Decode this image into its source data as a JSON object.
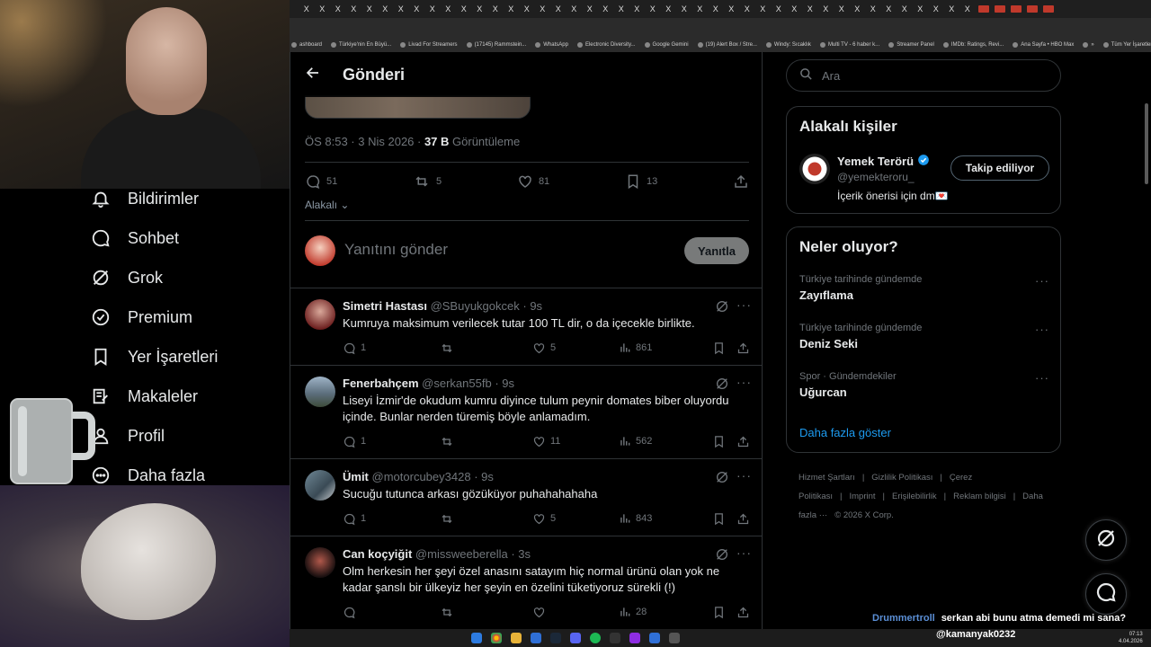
{
  "browser": {
    "tab_glyph": "X",
    "bookmarks": [
      "ashboard",
      "Türkiye'nin En Büyü...",
      "Livad For Streamers",
      "(17145) Rammstein...",
      "WhatsApp",
      "Electronic Diversity...",
      "Google Gemini",
      "(19) Alert Box / Stre...",
      "Windy: Sıcaklık",
      "Multi TV - 6 haber k...",
      "Streamer Panel",
      "IMDb: Ratings, Revi...",
      "Ana Sayfa • HBO Max",
      "»",
      "Tüm Yer İşaretleri"
    ]
  },
  "sidebar": {
    "items": [
      {
        "label": "Bildirimler",
        "icon": "bell-icon"
      },
      {
        "label": "Sohbet",
        "icon": "chat-icon"
      },
      {
        "label": "Grok",
        "icon": "grok-icon"
      },
      {
        "label": "Premium",
        "icon": "verified-icon"
      },
      {
        "label": "Yer İşaretleri",
        "icon": "bookmark-icon"
      },
      {
        "label": "Makaleler",
        "icon": "article-icon"
      },
      {
        "label": "Profil",
        "icon": "person-icon"
      },
      {
        "label": "Daha fazla",
        "icon": "more-circle-icon"
      }
    ]
  },
  "post": {
    "header_title": "Gönderi",
    "time": "ÖS 8:53 · 3 Nis 2026 · ",
    "views_count": "37 B",
    "views_label": " Görüntüleme",
    "replies": "51",
    "reposts": "5",
    "likes": "81",
    "bookmarks": "13",
    "related_label": "Alakalı",
    "reply_placeholder": "Yanıtını gönder",
    "reply_button": "Yanıtla"
  },
  "replies": [
    {
      "name": "Simetri Hastası",
      "handle": "@SBuyukgokcek",
      "time": "· 9s",
      "text": "Kumruya maksimum verilecek tutar 100 TL dir, o da içecekle birlikte.",
      "replies": "1",
      "reposts": "",
      "likes": "5",
      "views": "861"
    },
    {
      "name": "Fenerbahçem",
      "handle": "@serkan55fb",
      "time": "· 9s",
      "text": "Liseyi İzmir'de okudum kumru diyince tulum peynir domates biber oluyordu içinde. Bunlar nerden türemiş böyle anlamadım.",
      "replies": "1",
      "reposts": "",
      "likes": "11",
      "views": "562"
    },
    {
      "name": "Ümit",
      "handle": "@motorcubey3428",
      "time": "· 9s",
      "text": "Sucuğu tutunca arkası gözüküyor puhahahahaha",
      "replies": "1",
      "reposts": "",
      "likes": "5",
      "views": "843"
    },
    {
      "name": "Can koçyiğit",
      "handle": "@missweeberella",
      "time": "· 3s",
      "text": "Olm herkesin her şeyi özel anasını satayım hiç normal ürünü olan yok ne kadar şanslı bir ülkeyiz her şeyin en özelini tüketiyoruz sürekli (!)",
      "replies": "",
      "reposts": "",
      "likes": "",
      "views": "28"
    }
  ],
  "right": {
    "search_placeholder": "Ara",
    "people_title": "Alakalı kişiler",
    "person_name": "Yemek Terörü",
    "person_handle": "@yemekteroru_",
    "person_bio": "İçerik önerisi için dm💌",
    "follow_label": "Takip ediliyor",
    "trends_title": "Neler oluyor?",
    "trends": [
      {
        "context": "Türkiye tarihinde gündemde",
        "topic": "Zayıflama"
      },
      {
        "context": "Türkiye tarihinde gündemde",
        "topic": "Deniz Seki"
      },
      {
        "context": "Spor · Gündemdekiler",
        "topic": "Uğurcan"
      }
    ],
    "show_more": "Daha fazla göster",
    "footer": [
      "Hizmet Şartları",
      "|",
      "Gizlilik Politikası",
      "|",
      "Çerez Politikası",
      "|",
      "Imprint",
      "|",
      "Erişilebilirlik",
      "|",
      "Reklam bilgisi",
      "|",
      "Daha fazla ···",
      "© 2026 X Corp."
    ]
  },
  "chat": [
    {
      "user": "Drummertroll",
      "message": "serkan abi bunu atma demedi mi sana?"
    },
    {
      "user": "",
      "message": "@kamanyak0232"
    }
  ],
  "taskbar": {
    "time": "07:13",
    "date": "4.04.2026"
  },
  "colors": {
    "accent": "#1d9bf0",
    "border": "#2f3336",
    "muted": "#71767b",
    "reply_button": "#787a7a"
  }
}
